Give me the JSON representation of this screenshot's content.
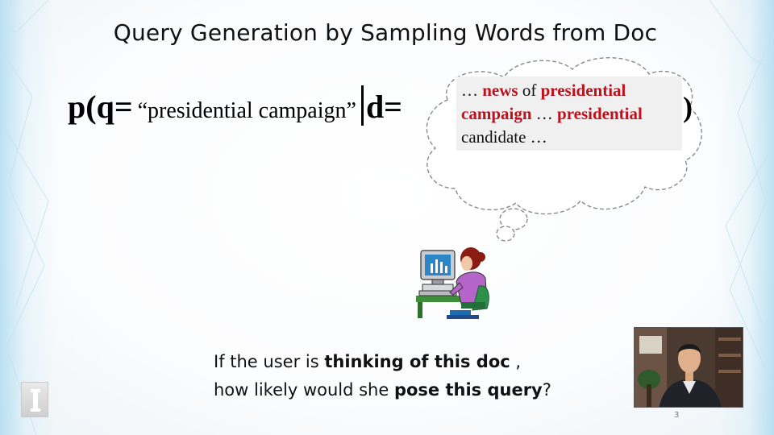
{
  "slide": {
    "title": "Query Generation by Sampling Words from Doc",
    "formula": {
      "prefix": "p(q=",
      "query_text": "“presidential campaign”",
      "given": "d=",
      "close": ")"
    },
    "doc_snippet": {
      "line1": {
        "lead": "… ",
        "w1": "news",
        "mid": " of ",
        "w2": "presidential"
      },
      "line2": {
        "w1": "campaign",
        "mid": " … ",
        "w2": "presidential"
      },
      "line3": "candidate …"
    },
    "question": {
      "line1_pre": "If the user is ",
      "line1_bold": "thinking of this doc",
      "line1_post": " ,",
      "line2_pre": "how likely would she ",
      "line2_bold": "pose this query",
      "line2_post": "?"
    },
    "page_number": "3"
  },
  "colors": {
    "highlight": "#c0101e",
    "edge_accent": "#8ccdeb"
  },
  "icons": [
    "user-at-computer-icon",
    "thought-cloud-icon",
    "logo-icon",
    "presenter-video"
  ]
}
